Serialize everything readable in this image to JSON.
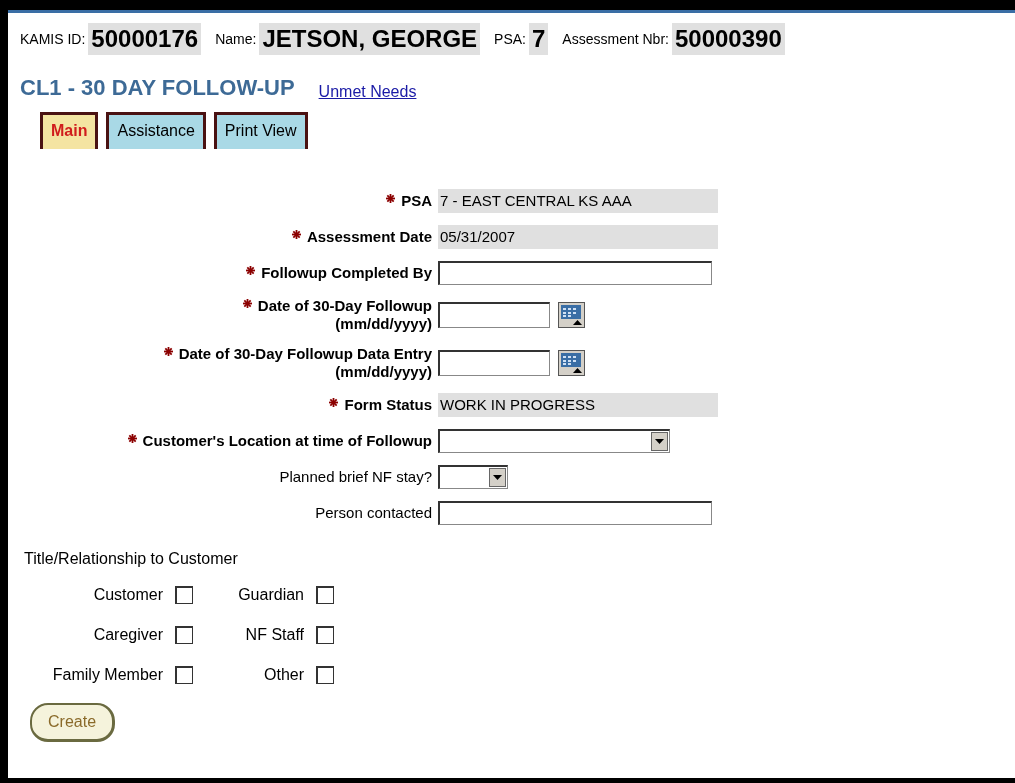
{
  "header": [
    {
      "label": "KAMIS ID:",
      "value": "50000176"
    },
    {
      "label": "Name:",
      "value": "JETSON, GEORGE"
    },
    {
      "label": "PSA:",
      "value": "7"
    },
    {
      "label": "Assessment Nbr:",
      "value": "50000390"
    }
  ],
  "title": "CL1 - 30 DAY FOLLOW-UP",
  "link": "Unmet Needs",
  "tabs": [
    {
      "label": "Main",
      "selected": true
    },
    {
      "label": "Assistance",
      "selected": false
    },
    {
      "label": "Print View",
      "selected": false
    }
  ],
  "fields": [
    {
      "kind": "readonly",
      "required": true,
      "label": "PSA",
      "value": "7 - EAST CENTRAL KS AAA"
    },
    {
      "kind": "readonly",
      "required": true,
      "label": "Assessment Date",
      "value": "05/31/2007"
    },
    {
      "kind": "text",
      "required": true,
      "label": "Followup Completed By"
    },
    {
      "kind": "date",
      "required": true,
      "label": "Date of 30-Day Followup",
      "sublabel": "(mm/dd/yyyy)"
    },
    {
      "kind": "date",
      "required": true,
      "label": "Date of 30-Day Followup Data Entry",
      "sublabel": "(mm/dd/yyyy)"
    },
    {
      "kind": "readonly",
      "required": true,
      "label": "Form Status",
      "value": "WORK IN PROGRESS"
    },
    {
      "kind": "select",
      "required": true,
      "label": "Customer's Location at time of Followup"
    },
    {
      "kind": "select_small",
      "required": false,
      "label": "Planned brief NF stay?"
    },
    {
      "kind": "text",
      "required": false,
      "label": "Person contacted"
    }
  ],
  "relationship": {
    "title": "Title/Relationship to Customer",
    "options": [
      {
        "label": "Customer",
        "checked": false
      },
      {
        "label": "Guardian",
        "checked": false
      },
      {
        "label": "Caregiver",
        "checked": false
      },
      {
        "label": "NF Staff",
        "checked": false
      },
      {
        "label": "Family Member",
        "checked": false
      },
      {
        "label": "Other",
        "checked": false
      }
    ]
  },
  "button": "Create"
}
